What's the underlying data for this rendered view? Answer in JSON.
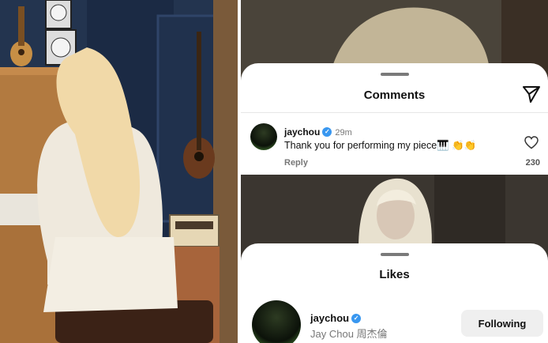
{
  "comments_sheet": {
    "title": "Comments",
    "comment": {
      "username": "jaychou",
      "time": "29m",
      "text": "Thank you for performing my piece🎹 👏👏",
      "reply_label": "Reply",
      "like_count": "230"
    }
  },
  "likes_sheet": {
    "title": "Likes",
    "user": {
      "username": "jaychou",
      "full_name": "Jay Chou 周杰倫",
      "follow_label": "Following"
    }
  },
  "icons": [
    "send-icon",
    "heart-icon",
    "verified-badge-icon"
  ],
  "colors": {
    "verified": "#3897f0",
    "button_bg": "#efefef"
  }
}
